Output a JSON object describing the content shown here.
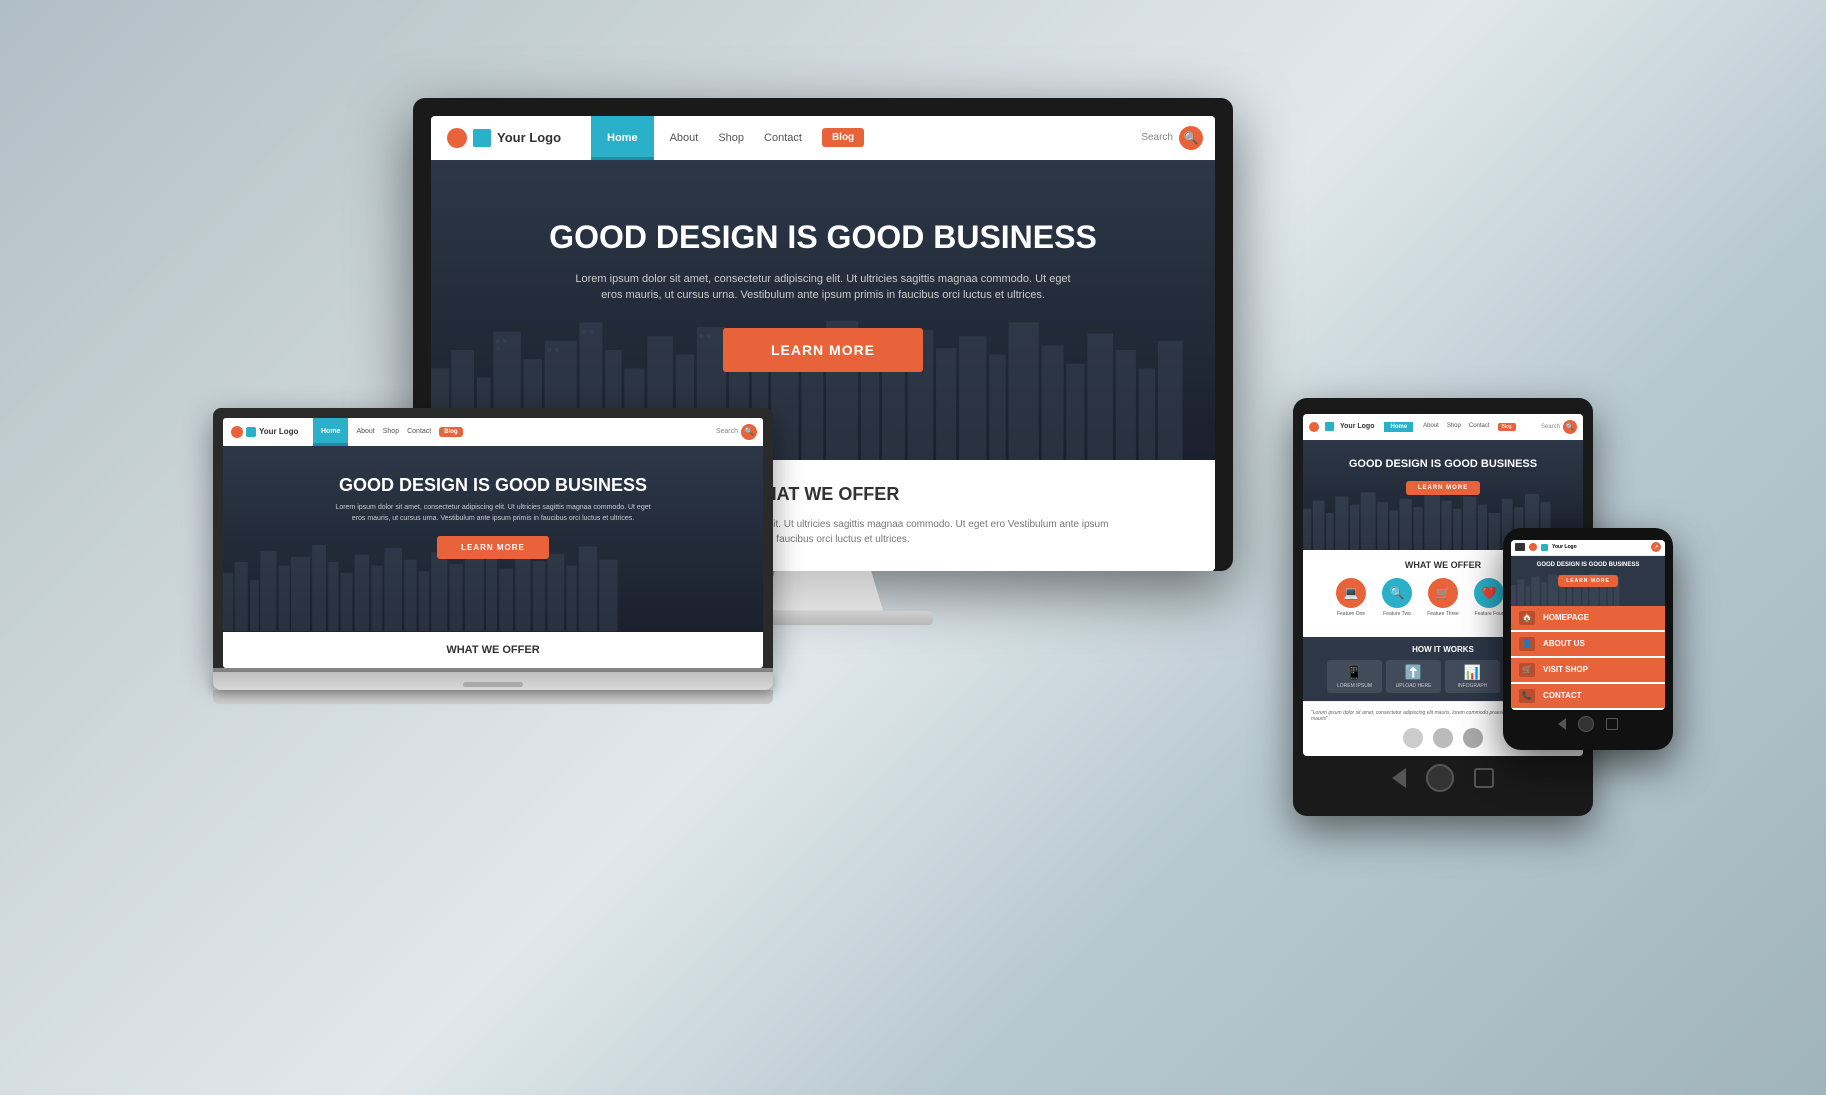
{
  "background": {
    "color_start": "#b0bec5",
    "color_end": "#a0b4bc"
  },
  "desktop": {
    "nav": {
      "logo_text": "Your Logo",
      "home_label": "Home",
      "about_label": "About",
      "shop_label": "Shop",
      "contact_label": "Contact",
      "blog_label": "Blog",
      "search_label": "Search"
    },
    "hero": {
      "title": "GOOD DESIGN IS GOOD BUSINESS",
      "subtitle": "Lorem ipsum dolor sit amet, consectetur adipiscing elit. Ut ultricies sagittis magnaa commodo.\nUt eget eros mauris, ut cursus urna. Vestibulum ante ipsum primis in faucibus orci luctus et ultrices.",
      "cta_label": "LEARN MORE"
    },
    "offer": {
      "title": "WHAT WE OFFER",
      "text": "Lorem ipsum dolor sit amet, consectetur adipiscing elit. Ut ultricies sagittis magnaa commodo. Ut eget ero\nVestibulum ante ipsum primis in faucibus orci luctus et ultrices."
    }
  },
  "laptop": {
    "nav": {
      "logo_text": "Your Logo",
      "home_label": "Home",
      "about_label": "About",
      "shop_label": "Shop",
      "contact_label": "Contact",
      "blog_label": "Blog",
      "search_label": "Search"
    },
    "hero": {
      "title": "GOOD DESIGN IS GOOD BUSINESS",
      "subtitle": "Lorem ipsum dolor sit amet, consectetur adipiscing elit. Ut ultricies sagittis magnaa commodo.\nUt eget eros mauris, ut cursus urna. Vestibulum ante ipsum primis in faucibus orci luctus et ultrices.",
      "cta_label": "LEARN MORE"
    },
    "offer": {
      "title": "WHAT WE OFFER"
    }
  },
  "tablet": {
    "hero_title": "GOOD DESIGN IS GOOD BUSINESS",
    "what_we_offer": "WHAT WE OFFER",
    "how_it_works": "HOW IT WORKS"
  },
  "mobile": {
    "menu_items": [
      {
        "label": "HOMEPAGE",
        "icon": "🏠"
      },
      {
        "label": "ABOUT US",
        "icon": "👤"
      },
      {
        "label": "VISIT SHOP",
        "icon": "🛒"
      },
      {
        "label": "CONTACT",
        "icon": "📞"
      }
    ],
    "hero_title": "GOOD DESIGN IS GOOD BUSINESS"
  }
}
